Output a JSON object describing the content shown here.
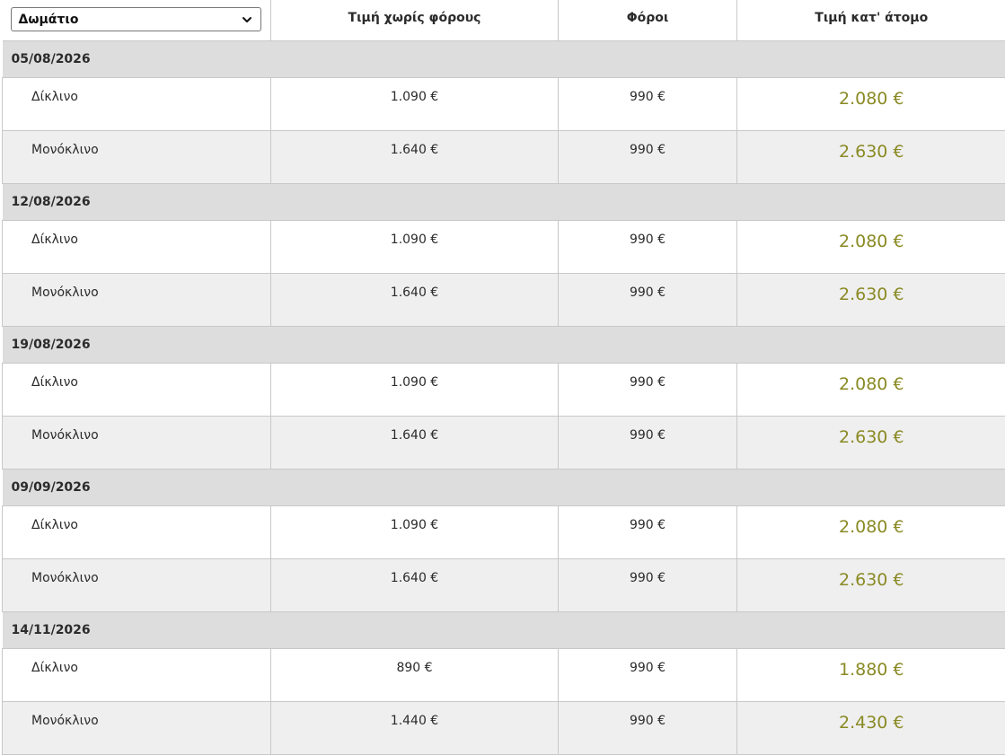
{
  "header": {
    "room_select_value": "Δωμάτιο",
    "col_price_no_tax": "Τιμή χωρίς φόρους",
    "col_taxes": "Φόροι",
    "col_price_per_person": "Τιμή κατ' άτομο"
  },
  "groups": [
    {
      "date": "05/08/2026",
      "rows": [
        {
          "room": "Δίκλινο",
          "price": "1.090 €",
          "tax": "990 €",
          "total": "2.080 €"
        },
        {
          "room": "Μονόκλινο",
          "price": "1.640 €",
          "tax": "990 €",
          "total": "2.630 €"
        }
      ]
    },
    {
      "date": "12/08/2026",
      "rows": [
        {
          "room": "Δίκλινο",
          "price": "1.090 €",
          "tax": "990 €",
          "total": "2.080 €"
        },
        {
          "room": "Μονόκλινο",
          "price": "1.640 €",
          "tax": "990 €",
          "total": "2.630 €"
        }
      ]
    },
    {
      "date": "19/08/2026",
      "rows": [
        {
          "room": "Δίκλινο",
          "price": "1.090 €",
          "tax": "990 €",
          "total": "2.080 €"
        },
        {
          "room": "Μονόκλινο",
          "price": "1.640 €",
          "tax": "990 €",
          "total": "2.630 €"
        }
      ]
    },
    {
      "date": "09/09/2026",
      "rows": [
        {
          "room": "Δίκλινο",
          "price": "1.090 €",
          "tax": "990 €",
          "total": "2.080 €"
        },
        {
          "room": "Μονόκλινο",
          "price": "1.640 €",
          "tax": "990 €",
          "total": "2.630 €"
        }
      ]
    },
    {
      "date": "14/11/2026",
      "rows": [
        {
          "room": "Δίκλινο",
          "price": "890 €",
          "tax": "990 €",
          "total": "1.880 €"
        },
        {
          "room": "Μονόκλινο",
          "price": "1.440 €",
          "tax": "990 €",
          "total": "2.430 €"
        }
      ]
    }
  ],
  "colors": {
    "total_price": "#8a8a25",
    "date_row_bg": "#dddddd",
    "alt_row_bg": "#efefef",
    "border": "#c8c8c8"
  },
  "icons": {
    "select_arrow": "chevron-down-icon"
  }
}
